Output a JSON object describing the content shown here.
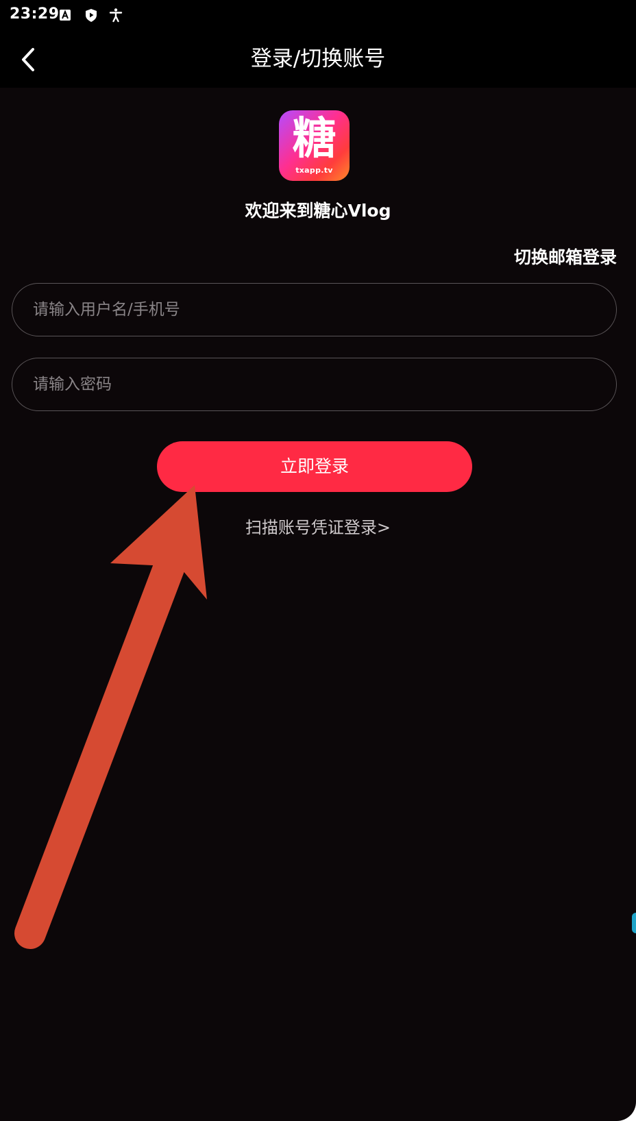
{
  "status_bar": {
    "time": "23:29",
    "icons": [
      "app-a-icon",
      "shield-play-icon",
      "accessibility-icon"
    ]
  },
  "app_bar": {
    "back_icon": "chevron-left-icon",
    "title": "登录/切换账号"
  },
  "logo": {
    "char": "糖",
    "domain": "txapp.tv"
  },
  "welcome_text": "欢迎来到糖心Vlog",
  "switch_email_label": "切换邮箱登录",
  "form": {
    "username_placeholder": "请输入用户名/手机号",
    "username_value": "",
    "password_placeholder": "请输入密码",
    "password_value": ""
  },
  "login_button_label": "立即登录",
  "scan_login_label": "扫描账号凭证登录>",
  "colors": {
    "background": "#0c0709",
    "accent": "#ff2a44",
    "annotation_arrow": "#d64a32"
  }
}
